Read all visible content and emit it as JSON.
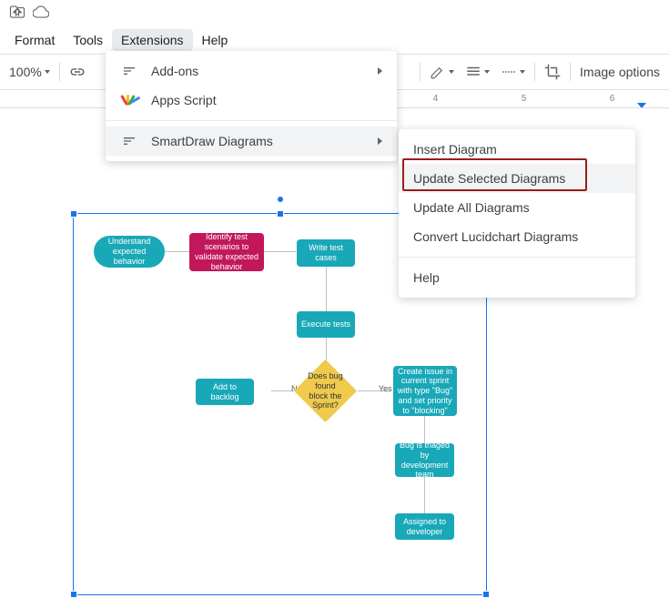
{
  "menubar": {
    "format": "Format",
    "tools": "Tools",
    "extensions": "Extensions",
    "help": "Help"
  },
  "toolbar": {
    "zoom": "100%",
    "image_options": "Image options"
  },
  "ruler": {
    "ticks": [
      "4",
      "5",
      "6"
    ]
  },
  "dropdown_extensions": {
    "addons": "Add-ons",
    "apps_script": "Apps Script",
    "smartdraw": "SmartDraw Diagrams"
  },
  "dropdown_smartdraw": {
    "insert": "Insert Diagram",
    "update_selected": "Update Selected Diagrams",
    "update_all": "Update All Diagrams",
    "convert": "Convert Lucidchart Diagrams",
    "help": "Help"
  },
  "diagram": {
    "understand": "Understand expected behavior",
    "identify": "Identify test scenarios to validate expected behavior",
    "write_tests": "Write test cases",
    "execute": "Execute tests",
    "add_backlog": "Add to backlog",
    "decision": "Does bug found block the Sprint?",
    "no": "No",
    "yes": "Yes",
    "create_issue": "Create issue in current sprint with type \"Bug\" and set priority to \"blocking\"",
    "triaged": "Bug is triaged by development team",
    "assigned": "Assigned to developer"
  }
}
